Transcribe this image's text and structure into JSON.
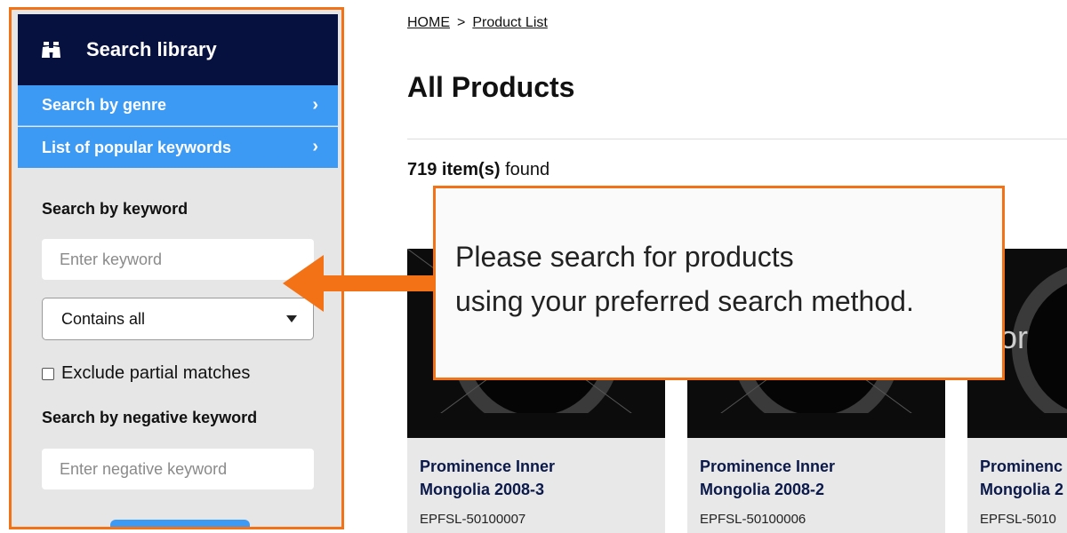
{
  "sidebar": {
    "header_title": "Search library",
    "genre_label": "Search by genre",
    "popular_label": "List of popular keywords",
    "keyword_label": "Search by keyword",
    "keyword_placeholder": "Enter keyword",
    "match_value": "Contains all",
    "exclude_label": "Exclude partial matches",
    "negative_label": "Search by negative keyword",
    "negative_placeholder": "Enter negative keyword"
  },
  "breadcrumb": {
    "home": "HOME",
    "separator": ">",
    "current": "Product List"
  },
  "main": {
    "title": "All Products",
    "results_count": "719 item(s)",
    "results_suffix": "found"
  },
  "cards": [
    {
      "title_line1": "Prominence Inner",
      "title_line2": "Mongolia 2008-3",
      "code": "EPFSL-50100007"
    },
    {
      "title_line1": "Prominence Inner",
      "title_line2": "Mongolia 2008-2",
      "code": "EPFSL-50100006"
    },
    {
      "title_line1": "Prominenc",
      "title_line2": "Mongolia 2",
      "code": "EPFSL-5010",
      "thumb_text": "Dor"
    }
  ],
  "callout": {
    "line1": "Please search for products",
    "line2": "using your preferred search method."
  },
  "colors": {
    "accent_orange": "#f47216",
    "navy": "#071140",
    "blue": "#3c99f4"
  }
}
